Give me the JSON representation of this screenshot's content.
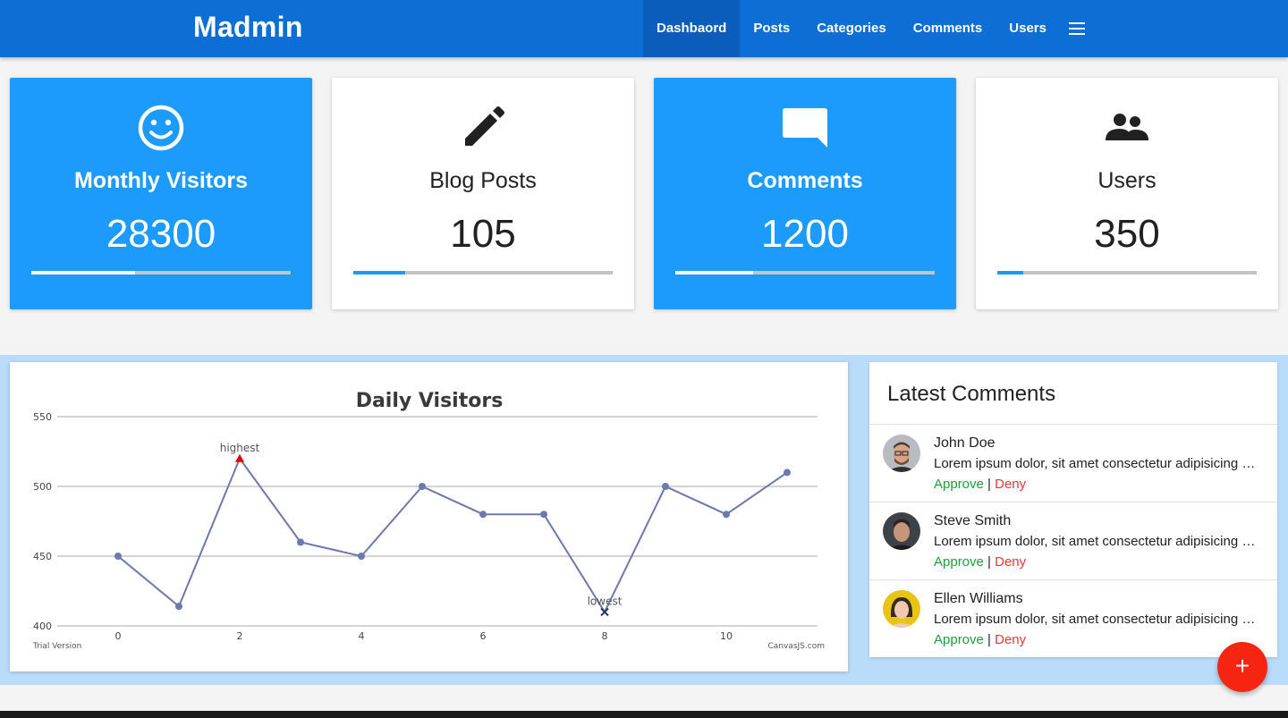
{
  "navbar": {
    "brand": "Madmin",
    "items": [
      {
        "label": "Dashbaord",
        "active": true
      },
      {
        "label": "Posts"
      },
      {
        "label": "Categories"
      },
      {
        "label": "Comments"
      },
      {
        "label": "Users"
      }
    ],
    "menu_icon": "hamburger-menu-icon",
    "color": "#0d6fd6"
  },
  "stats": [
    {
      "label": "Monthly Visitors",
      "value": "28300",
      "icon": "smiley-icon",
      "progress": 0.4,
      "theme": "blue"
    },
    {
      "label": "Blog Posts",
      "value": "105",
      "icon": "pencil-icon",
      "progress": 0.2,
      "theme": "white"
    },
    {
      "label": "Comments",
      "value": "1200",
      "icon": "comment-icon",
      "progress": 0.3,
      "theme": "blue"
    },
    {
      "label": "Users",
      "value": "350",
      "icon": "users-icon",
      "progress": 0.1,
      "theme": "white"
    }
  ],
  "colors": {
    "accent": "#1d9bfd",
    "fab": "#f52512",
    "approve": "#1e9e3a",
    "deny": "#e53935",
    "line": "#6d78ad"
  },
  "chart_data": {
    "type": "line",
    "title": "Daily Visitors",
    "x": [
      0,
      1,
      2,
      3,
      4,
      5,
      6,
      7,
      8,
      9,
      10,
      11
    ],
    "values": [
      450,
      414,
      520,
      460,
      450,
      500,
      480,
      480,
      410,
      500,
      480,
      510
    ],
    "xticks": [
      0,
      2,
      4,
      6,
      8,
      10
    ],
    "yticks": [
      400,
      450,
      500,
      550
    ],
    "xlim": [
      -1,
      11.5
    ],
    "ylim": [
      400,
      550
    ],
    "grid": true,
    "annotations": [
      {
        "x": 2,
        "y": 520,
        "text": "highest",
        "marker": "triangle",
        "color": "#e00000"
      },
      {
        "x": 8,
        "y": 410,
        "text": "lowest",
        "marker": "cross",
        "color": "#1a3a5a"
      }
    ],
    "footer_left": "Trial Version",
    "footer_right": "CanvasJS.com"
  },
  "comments": {
    "title": "Latest Comments",
    "items": [
      {
        "name": "John Doe",
        "text": "Lorem ipsum dolor, sit amet consectetur adipisicing elit.",
        "approve": "Approve",
        "deny": "Deny"
      },
      {
        "name": "Steve Smith",
        "text": "Lorem ipsum dolor, sit amet consectetur adipisicing elit.",
        "approve": "Approve",
        "deny": "Deny"
      },
      {
        "name": "Ellen Williams",
        "text": "Lorem ipsum dolor, sit amet consectetur adipisicing elit.",
        "approve": "Approve",
        "deny": "Deny"
      }
    ],
    "separator": "|"
  },
  "fab": {
    "label": "+",
    "icon": "plus-icon"
  }
}
